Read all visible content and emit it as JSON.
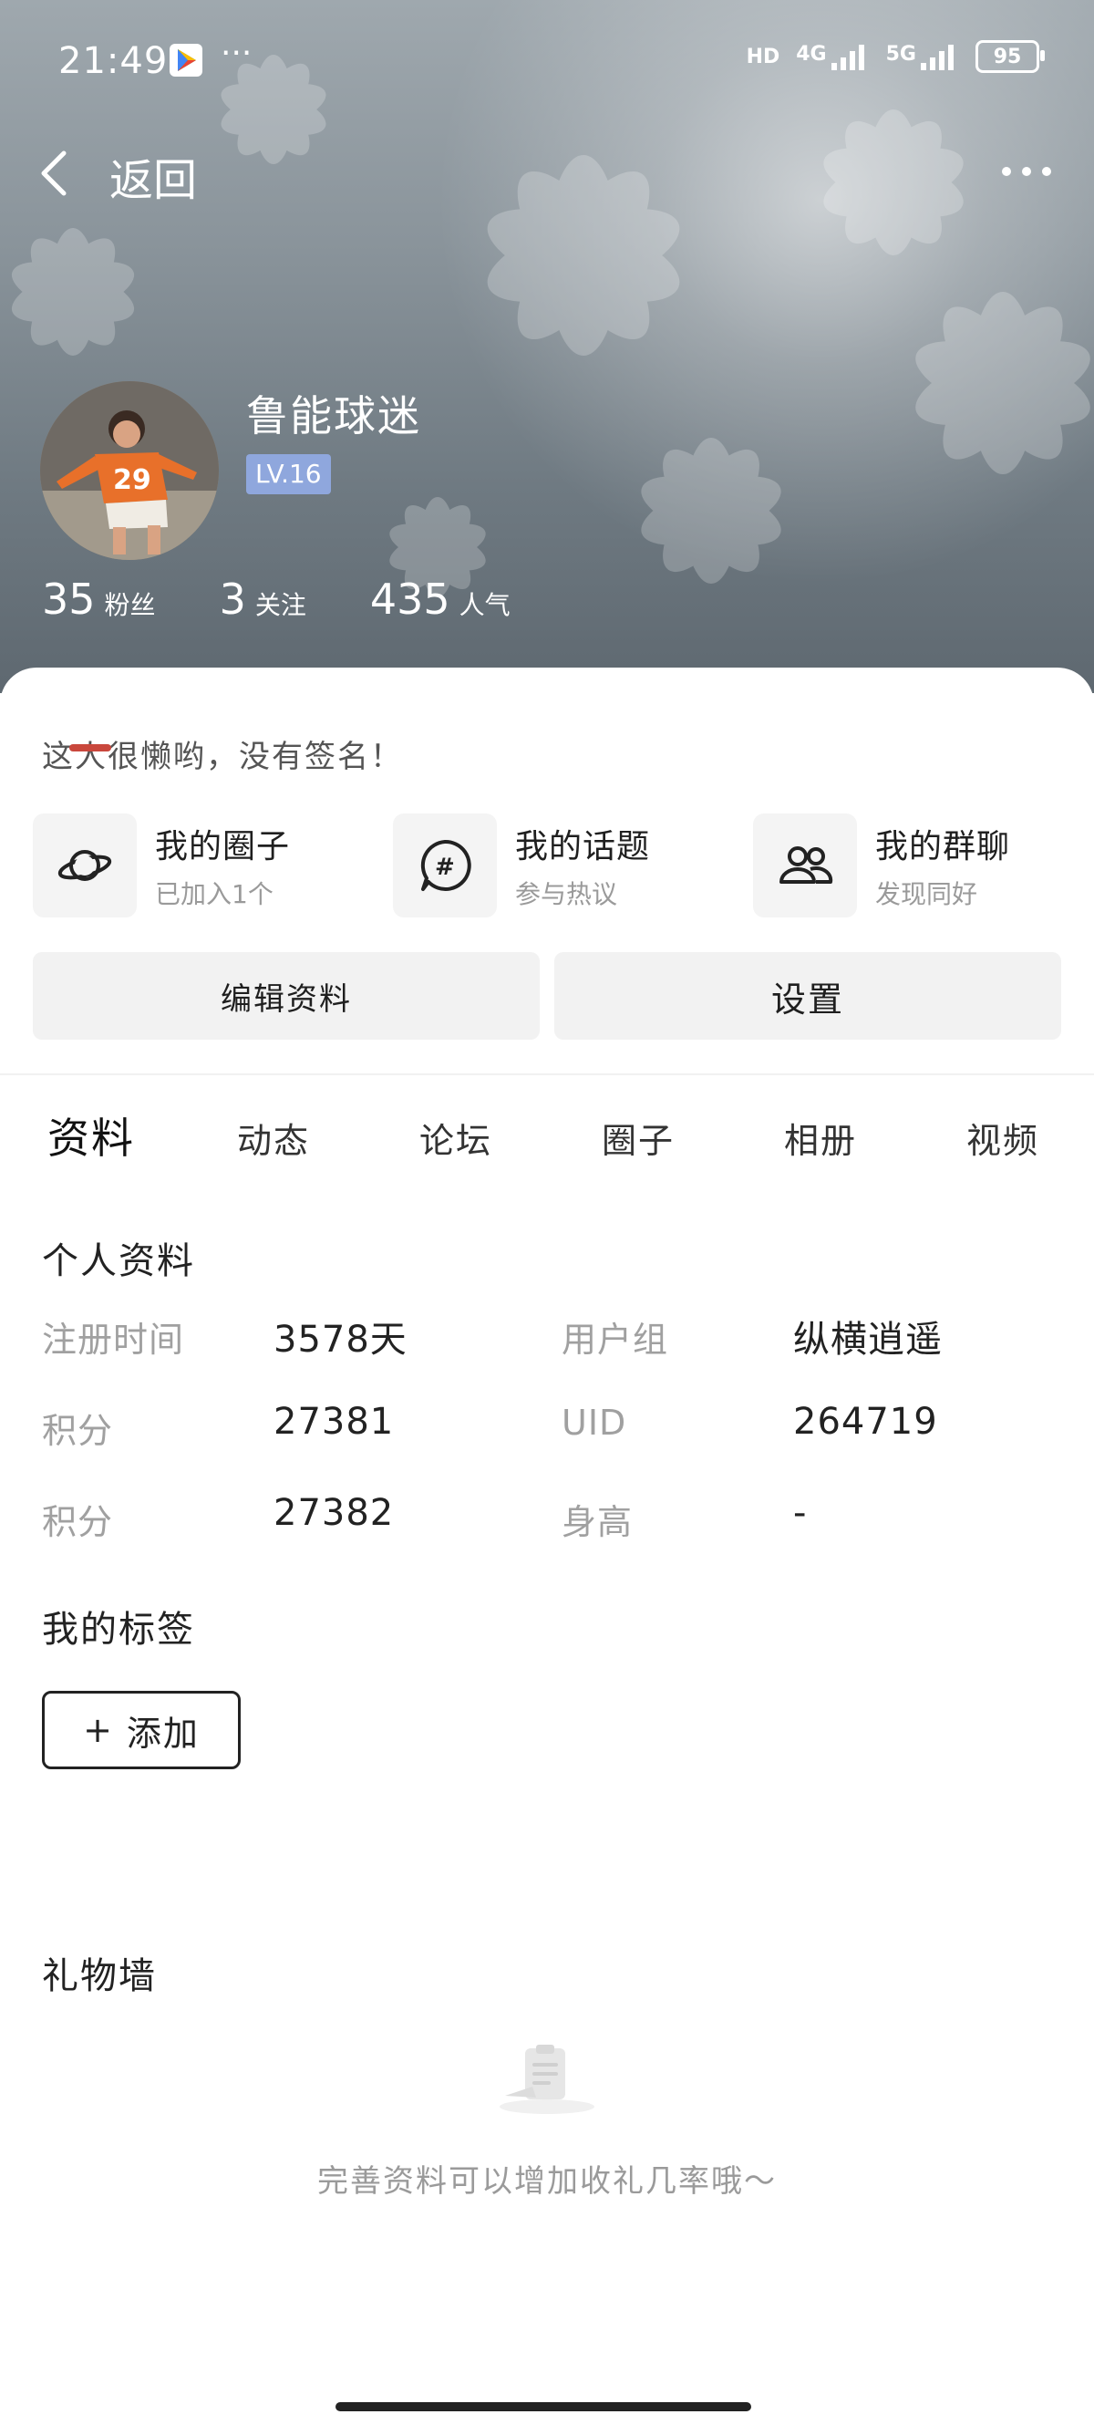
{
  "status_bar": {
    "time": "21:49",
    "dots": "···",
    "hd": "HD",
    "net1": "4G",
    "net2": "5G",
    "battery": "95"
  },
  "header": {
    "back_label": "返回"
  },
  "profile": {
    "nickname": "鲁能球迷",
    "level": "LV.16",
    "stats": [
      {
        "value": "35",
        "label": "粉丝"
      },
      {
        "value": "3",
        "label": "关注"
      },
      {
        "value": "435",
        "label": "人气"
      }
    ],
    "signature": "这人很懒哟，没有签名！"
  },
  "features": [
    {
      "icon": "planet-icon",
      "title": "我的圈子",
      "sub": "已加入1个"
    },
    {
      "icon": "hashtag-icon",
      "title": "我的话题",
      "sub": "参与热议"
    },
    {
      "icon": "group-icon",
      "title": "我的群聊",
      "sub": "发现同好"
    }
  ],
  "actions": {
    "edit": "编辑资料",
    "settings": "设置"
  },
  "tabs": [
    "资料",
    "动态",
    "论坛",
    "圈子",
    "相册",
    "视频"
  ],
  "active_tab": "资料",
  "accent_color": "#c9473c",
  "personal_info": {
    "title": "个人资料",
    "rows": [
      {
        "label1": "注册时间",
        "value1": "3578天",
        "label2": "用户组",
        "value2": "纵横逍遥"
      },
      {
        "label1": "积分",
        "value1": "27381",
        "label2": "UID",
        "value2": "264719"
      },
      {
        "label1": "积分",
        "value1": "27382",
        "label2": "身高",
        "value2": "-"
      }
    ]
  },
  "tags": {
    "title": "我的标签",
    "add_label": "添加",
    "add_plus": "+"
  },
  "gifts": {
    "title": "礼物墙",
    "empty_text": "完善资料可以增加收礼几率哦～"
  }
}
